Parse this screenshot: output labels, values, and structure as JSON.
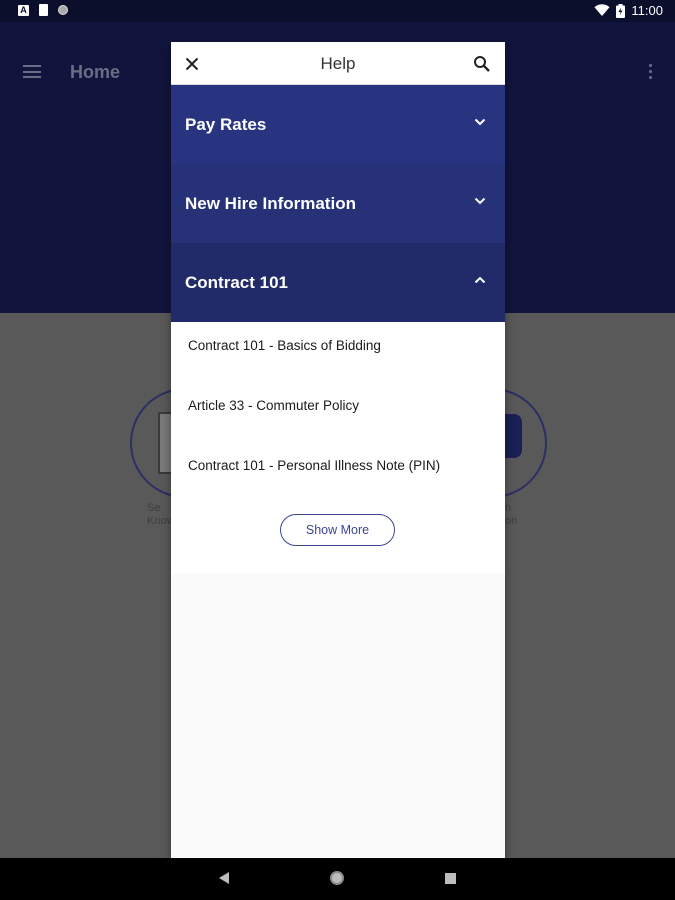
{
  "status_bar": {
    "time": "11:00",
    "icons": [
      "notification-a-icon",
      "sd-card-icon",
      "circle-notification-icon",
      "wifi-icon",
      "battery-icon"
    ]
  },
  "app": {
    "title": "Home",
    "bg_left_caption": "Se\nKnow",
    "bg_right_caption": "h\non"
  },
  "help_modal": {
    "title": "Help",
    "sections": [
      {
        "label": "Pay Rates",
        "expanded": false
      },
      {
        "label": "New Hire Information",
        "expanded": false
      },
      {
        "label": "Contract 101",
        "expanded": true
      }
    ],
    "articles": [
      "Contract 101 - Basics of Bidding",
      "Article 33 - Commuter Policy",
      "Contract 101 - Personal Illness Note (PIN)"
    ],
    "show_more_label": "Show More"
  },
  "colors": {
    "header_bg": "#11153d",
    "section_bg": "#283480",
    "accent": "#3c4593"
  }
}
